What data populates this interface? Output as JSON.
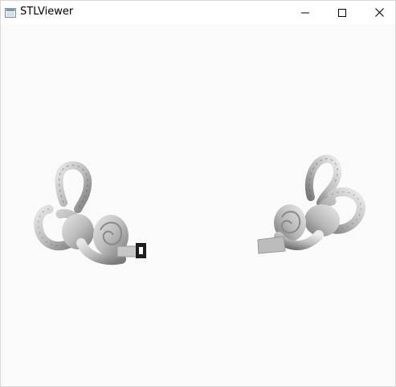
{
  "window": {
    "title": "STLViewer",
    "background": "#fafafa"
  },
  "titlebar": {
    "icons": {
      "app": "window-app-icon",
      "minimize": "minimize-icon",
      "maximize": "maximize-icon",
      "close": "close-icon"
    }
  },
  "viewport": {
    "models": [
      "left-inner-ear-model",
      "right-inner-ear-model"
    ],
    "model_color": "#c8c8c8"
  }
}
